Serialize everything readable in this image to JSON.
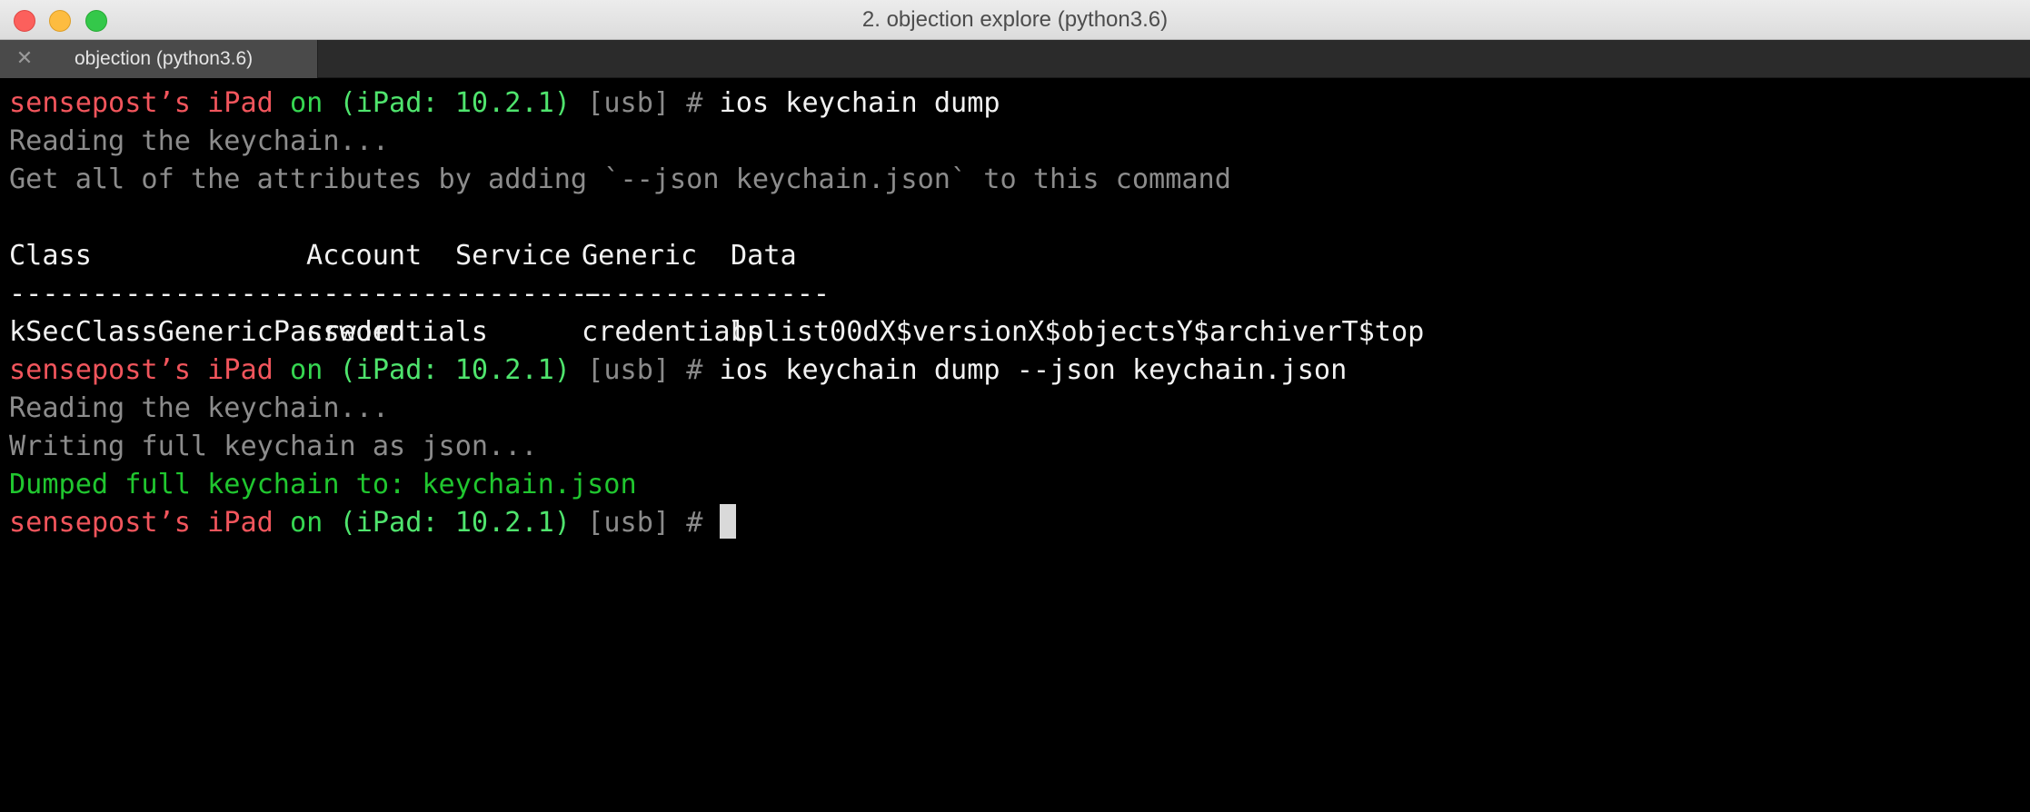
{
  "window": {
    "title": "2. objection explore (python3.6)"
  },
  "tabs": [
    {
      "label": "objection (python3.6)",
      "close_icon": "close-icon"
    }
  ],
  "prompt": {
    "user": "sensepost’s iPad",
    "on": "on",
    "device": "(iPad: 10.2.1)",
    "transport": "[usb]",
    "symbol": "#"
  },
  "terminal": {
    "cmd1": "ios keychain dump",
    "out1": "Reading the keychain...",
    "out2": "Get all of the attributes by adding `--json keychain.json` to this command",
    "table": {
      "headers": [
        "Class",
        "Account",
        "Service",
        "Generic",
        "Data"
      ],
      "separators": [
        "------------------------",
        "-----------",
        "---------",
        "-----------",
        "------"
      ],
      "rows": [
        [
          "kSecClassGenericPassword",
          "credentials",
          "",
          "credentials",
          "bplist00dX$versionX$objectsY$archiverT$top"
        ]
      ]
    },
    "cmd2": "ios keychain dump --json keychain.json",
    "out3": "Reading the keychain...",
    "out4": "Writing full keychain as json...",
    "out5": "Dumped full keychain to: keychain.json"
  },
  "colors": {
    "prompt_user": "#f1555c",
    "prompt_on": "#36d651",
    "prompt_device": "#4fe46d",
    "prompt_transport": "#8a8a8a",
    "success": "#20c62f",
    "muted_output": "#8c8c8c",
    "background": "#000000"
  }
}
